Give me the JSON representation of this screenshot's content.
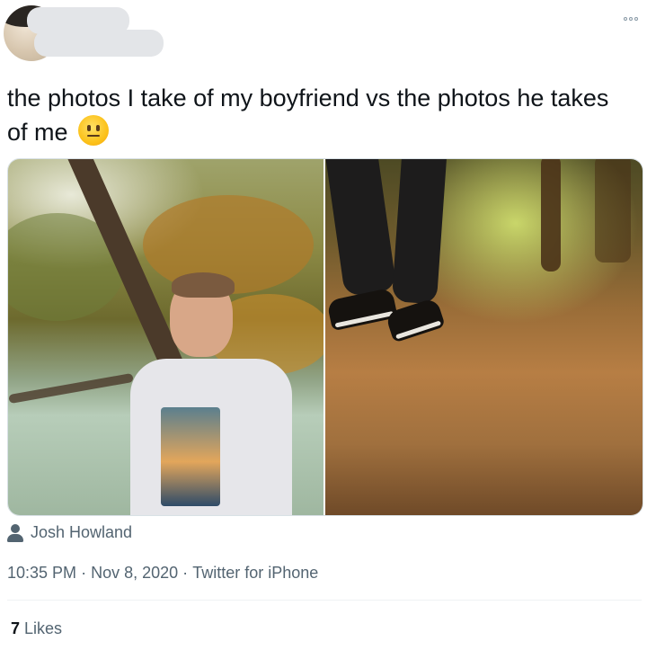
{
  "tweet": {
    "text": "the photos I take of my boyfriend vs the photos he takes of me",
    "emoji": "neutral-face-emoji"
  },
  "media": {
    "photo_credit": "Josh Howland"
  },
  "meta": {
    "time": "10:35 PM",
    "separator": "·",
    "date": "Nov 8, 2020",
    "source": "Twitter for iPhone"
  },
  "engagement": {
    "likes_count": "7",
    "likes_label": "Likes"
  },
  "icons": {
    "more": "more-options-icon",
    "user": "user-icon"
  }
}
